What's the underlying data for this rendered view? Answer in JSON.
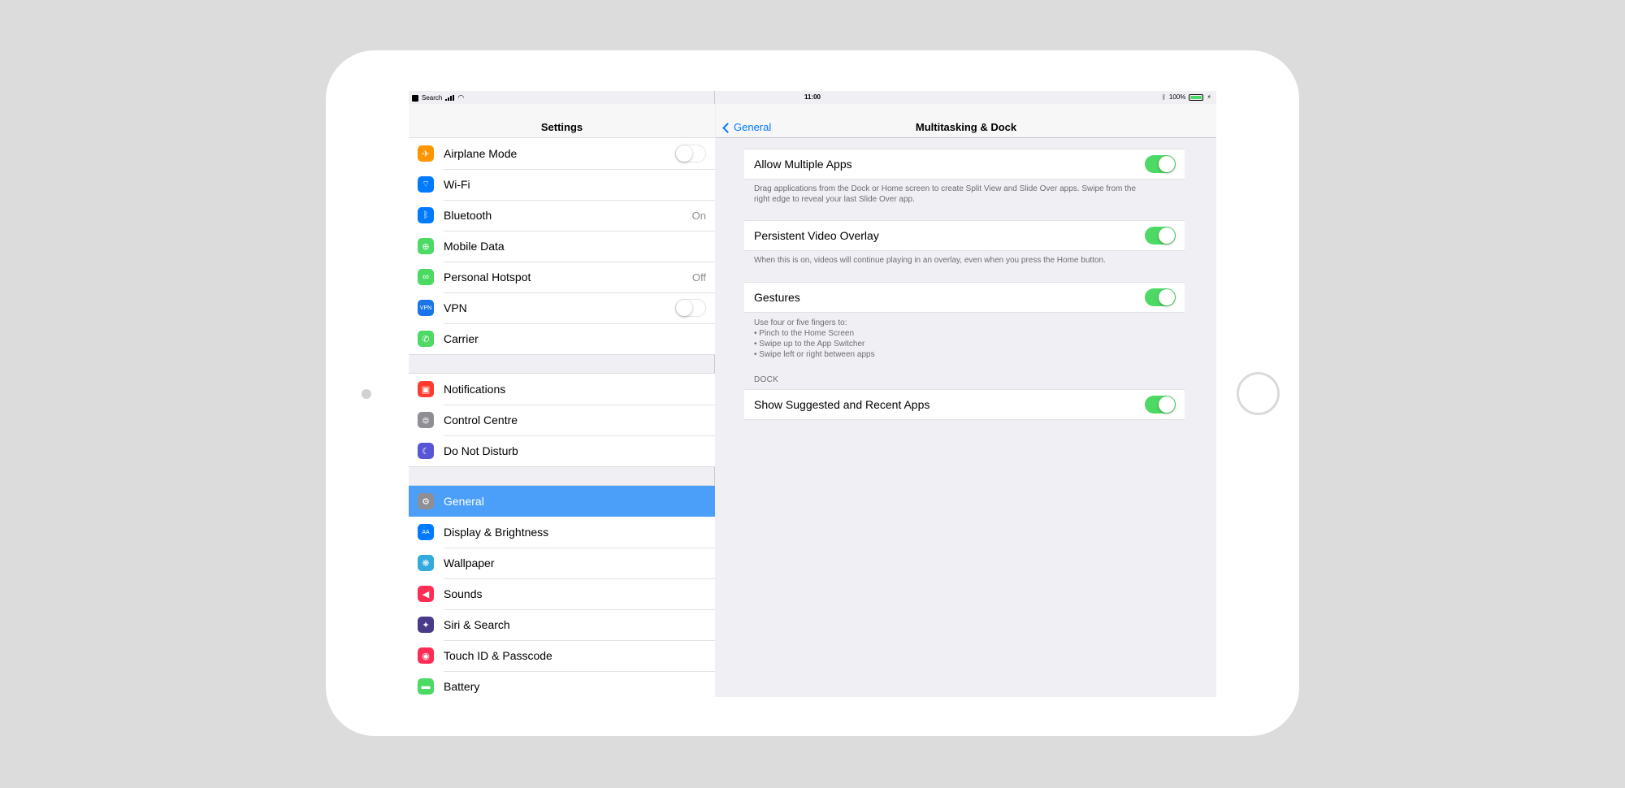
{
  "status_bar": {
    "back_app": "Search",
    "time": "11:00",
    "battery": "100%",
    "battery_level": 1.0
  },
  "master": {
    "title": "Settings",
    "groups": [
      [
        {
          "label": "Airplane Mode",
          "icon": "airplane-icon",
          "color": "#ff9500",
          "glyph": "✈",
          "toggle": false
        },
        {
          "label": "Wi-Fi",
          "icon": "wifi-icon",
          "color": "#007aff",
          "glyph": "⌔"
        },
        {
          "label": "Bluetooth",
          "icon": "bluetooth-icon",
          "color": "#007aff",
          "glyph": "ᛒ",
          "value": "On"
        },
        {
          "label": "Mobile Data",
          "icon": "antenna-icon",
          "color": "#4cd964",
          "glyph": "⊕"
        },
        {
          "label": "Personal Hotspot",
          "icon": "hotspot-icon",
          "color": "#4cd964",
          "glyph": "∞",
          "value": "Off"
        },
        {
          "label": "VPN",
          "icon": "vpn-icon",
          "color": "#1a74e8",
          "glyph": "VPN",
          "toggle": false
        },
        {
          "label": "Carrier",
          "icon": "phone-icon",
          "color": "#4cd964",
          "glyph": "✆"
        }
      ],
      [
        {
          "label": "Notifications",
          "icon": "notifications-icon",
          "color": "#ff3b30",
          "glyph": "▣"
        },
        {
          "label": "Control Centre",
          "icon": "control-centre-icon",
          "color": "#8e8e93",
          "glyph": "⊜"
        },
        {
          "label": "Do Not Disturb",
          "icon": "moon-icon",
          "color": "#5856d6",
          "glyph": "☾"
        }
      ],
      [
        {
          "label": "General",
          "icon": "gear-icon",
          "color": "#8e8e93",
          "glyph": "⚙",
          "selected": true
        },
        {
          "label": "Display & Brightness",
          "icon": "display-icon",
          "color": "#007aff",
          "glyph": "AA"
        },
        {
          "label": "Wallpaper",
          "icon": "wallpaper-icon",
          "color": "#34aadc",
          "glyph": "❋"
        },
        {
          "label": "Sounds",
          "icon": "speaker-icon",
          "color": "#ff2d55",
          "glyph": "◀"
        },
        {
          "label": "Siri & Search",
          "icon": "siri-icon",
          "color": "#4a3a8a",
          "glyph": "✦"
        },
        {
          "label": "Touch ID & Passcode",
          "icon": "fingerprint-icon",
          "color": "#ff2d55",
          "glyph": "◉"
        },
        {
          "label": "Battery",
          "icon": "battery-icon",
          "color": "#4cd964",
          "glyph": "▬"
        }
      ]
    ]
  },
  "detail": {
    "back_label": "General",
    "title": "Multitasking & Dock",
    "allow_multiple_apps": {
      "label": "Allow Multiple Apps",
      "on": true,
      "footnote_line1": "Drag applications from the Dock or Home screen to create Split View and Slide Over apps. Swipe from the",
      "footnote_line2": "right edge to reveal your last Slide Over app."
    },
    "persistent_video": {
      "label": "Persistent Video Overlay",
      "on": true,
      "footnote": "When this is on, videos will continue playing in an overlay, even when you press the Home button."
    },
    "gestures": {
      "label": "Gestures",
      "on": true,
      "footnote_lines": [
        "Use four or five fingers to:",
        "• Pinch to the Home Screen",
        "• Swipe up to the App Switcher",
        "• Swipe left or right between apps"
      ]
    },
    "dock_header": "DOCK",
    "suggested_apps": {
      "label": "Show Suggested and Recent Apps",
      "on": true
    }
  }
}
